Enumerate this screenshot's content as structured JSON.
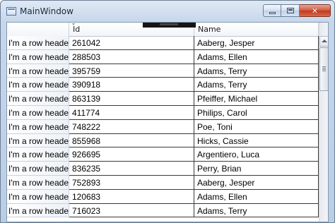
{
  "window": {
    "title": "MainWindow",
    "close_glyph": "✕"
  },
  "grid": {
    "columns": [
      "Id",
      "Name"
    ],
    "rows": [
      {
        "header": "I'm a row header!",
        "id": "261042",
        "name": "Aaberg, Jesper"
      },
      {
        "header": "I'm a row header!",
        "id": "288503",
        "name": "Adams, Ellen"
      },
      {
        "header": "I'm a row header!",
        "id": "395759",
        "name": "Adams, Terry"
      },
      {
        "header": "I'm a row header!",
        "id": "390918",
        "name": "Adams, Terry"
      },
      {
        "header": "I'm a row header!",
        "id": "863139",
        "name": "Pfeiffer, Michael"
      },
      {
        "header": "I'm a row header!",
        "id": "411774",
        "name": "Philips, Carol"
      },
      {
        "header": "I'm a row header!",
        "id": "748222",
        "name": "Poe, Toni"
      },
      {
        "header": "I'm a row header!",
        "id": "855968",
        "name": "Hicks, Cassie"
      },
      {
        "header": "I'm a row header!",
        "id": "926695",
        "name": "Argentiero, Luca"
      },
      {
        "header": "I'm a row header!",
        "id": "836235",
        "name": "Perry, Brian"
      },
      {
        "header": "I'm a row header!",
        "id": "752893",
        "name": "Aaberg, Jesper"
      },
      {
        "header": "I'm a row header!",
        "id": "120683",
        "name": "Adams, Ellen"
      },
      {
        "header": "I'm a row header!",
        "id": "716023",
        "name": "Adams, Terry"
      }
    ]
  },
  "colors": {
    "titlebar": "#c6d7ec",
    "grid_line": "#3a3a3a",
    "close_button": "#c0391c"
  }
}
